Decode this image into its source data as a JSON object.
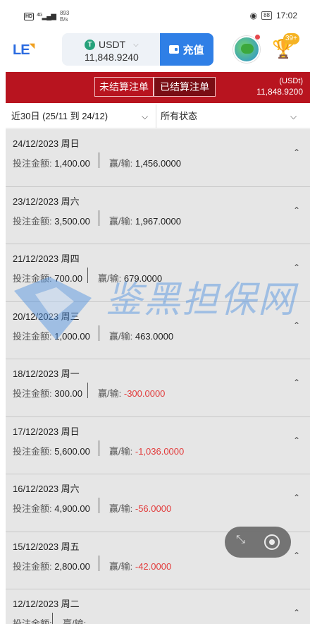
{
  "status_bar": {
    "network": "HD",
    "signal": "4G",
    "speed_value": "893",
    "speed_unit": "B/s",
    "battery": "88",
    "time": "17:02"
  },
  "header": {
    "logo": "LE",
    "currency": "USDT",
    "wallet_amount": "11,848.9240",
    "deposit_label": "充值",
    "trophy_badge": "39+"
  },
  "tabs": {
    "unsettled": "未结算注单",
    "settled": "已结算注单",
    "balance_label": "(USDt)",
    "balance_amount": "11,848.9200"
  },
  "filters": {
    "date_range": "近30日 (25/11 到 24/12)",
    "status": "所有状态"
  },
  "labels": {
    "stake": "投注金额:",
    "win_loss": "赢/输:"
  },
  "rows": [
    {
      "date": "24/12/2023 周日",
      "stake": "1,400.00",
      "win": "1,456.0000",
      "negative": false
    },
    {
      "date": "23/12/2023 周六",
      "stake": "3,500.00",
      "win": "1,967.0000",
      "negative": false
    },
    {
      "date": "21/12/2023 周四",
      "stake": "700.00",
      "win": "679.0000",
      "negative": false
    },
    {
      "date": "20/12/2023 周三",
      "stake": "1,000.00",
      "win": "463.0000",
      "negative": false
    },
    {
      "date": "18/12/2023 周一",
      "stake": "300.00",
      "win": "-300.0000",
      "negative": true
    },
    {
      "date": "17/12/2023 周日",
      "stake": "5,600.00",
      "win": "-1,036.0000",
      "negative": true
    },
    {
      "date": "16/12/2023 周六",
      "stake": "4,900.00",
      "win": "-56.0000",
      "negative": true
    },
    {
      "date": "15/12/2023 周五",
      "stake": "2,800.00",
      "win": "-42.0000",
      "negative": true
    },
    {
      "date": "12/12/2023 周二",
      "stake": "",
      "win": "",
      "negative": false
    }
  ],
  "watermark": "鉴黑担保网",
  "colors": {
    "accent_red": "#b8141f",
    "active_tab": "#7a0d14",
    "deposit_blue": "#2f7fe6",
    "negative": "#e23b3b",
    "usdt_green": "#26a17b"
  }
}
